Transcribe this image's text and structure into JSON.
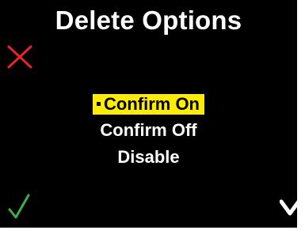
{
  "screen": {
    "title": "Delete Options",
    "colors": {
      "background": "#000000",
      "text": "#ffffff",
      "highlight": "#ffec00",
      "cancel": "#e8232a",
      "confirm": "#3fae49"
    }
  },
  "menu": {
    "options": [
      {
        "label": "Confirm On",
        "selected": true
      },
      {
        "label": "Confirm Off",
        "selected": false
      },
      {
        "label": "Disable",
        "selected": false
      }
    ]
  },
  "softkeys": {
    "top_left": "x-icon",
    "bottom_left": "checkmark-icon",
    "bottom_right": "chevron-down-icon"
  }
}
